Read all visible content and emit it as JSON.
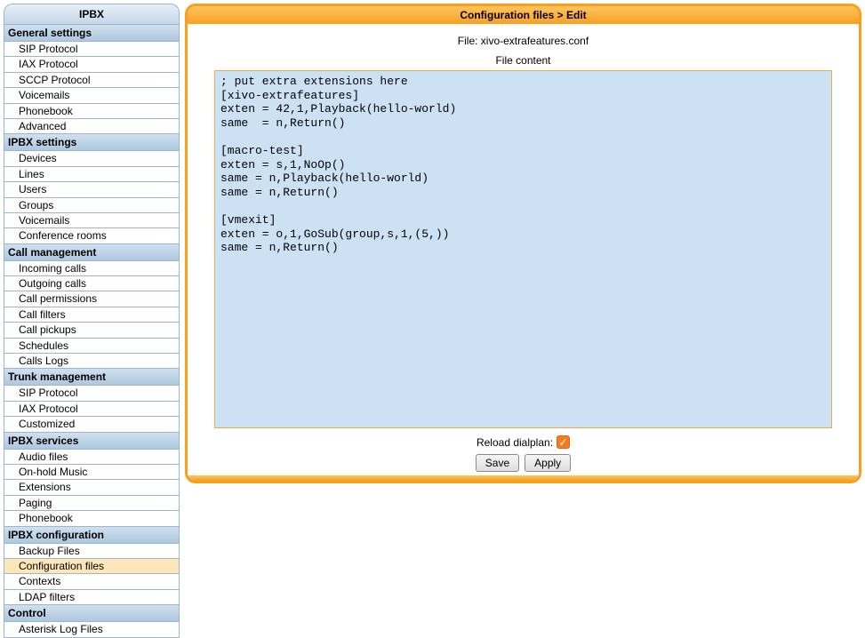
{
  "sidebar": {
    "title": "IPBX",
    "sections": [
      {
        "header": "General settings",
        "items": [
          "SIP Protocol",
          "IAX Protocol",
          "SCCP Protocol",
          "Voicemails",
          "Phonebook",
          "Advanced"
        ]
      },
      {
        "header": "IPBX settings",
        "items": [
          "Devices",
          "Lines",
          "Users",
          "Groups",
          "Voicemails",
          "Conference rooms"
        ]
      },
      {
        "header": "Call management",
        "items": [
          "Incoming calls",
          "Outgoing calls",
          "Call permissions",
          "Call filters",
          "Call pickups",
          "Schedules",
          "Calls Logs"
        ]
      },
      {
        "header": "Trunk management",
        "items": [
          "SIP Protocol",
          "IAX Protocol",
          "Customized"
        ]
      },
      {
        "header": "IPBX services",
        "items": [
          "Audio files",
          "On-hold Music",
          "Extensions",
          "Paging",
          "Phonebook"
        ]
      },
      {
        "header": "IPBX configuration",
        "items": [
          "Backup Files",
          "Configuration files",
          "Contexts",
          "LDAP filters"
        ]
      },
      {
        "header": "Control",
        "items": [
          "Asterisk Log Files"
        ]
      }
    ],
    "active": "Configuration files"
  },
  "main": {
    "breadcrumb": "Configuration files > Edit",
    "file_label": "File: xivo-extrafeatures.conf",
    "content_label": "File content",
    "file_content": "; put extra extensions here\n[xivo-extrafeatures]\nexten = 42,1,Playback(hello-world)\nsame  = n,Return()\n\n[macro-test]\nexten = s,1,NoOp()\nsame = n,Playback(hello-world)\nsame = n,Return()\n\n[vmexit]\nexten = o,1,GoSub(group,s,1,(5,))\nsame = n,Return()\n",
    "reload_label": "Reload dialplan:",
    "reload_checked": true,
    "buttons": {
      "save": "Save",
      "apply": "Apply"
    }
  }
}
